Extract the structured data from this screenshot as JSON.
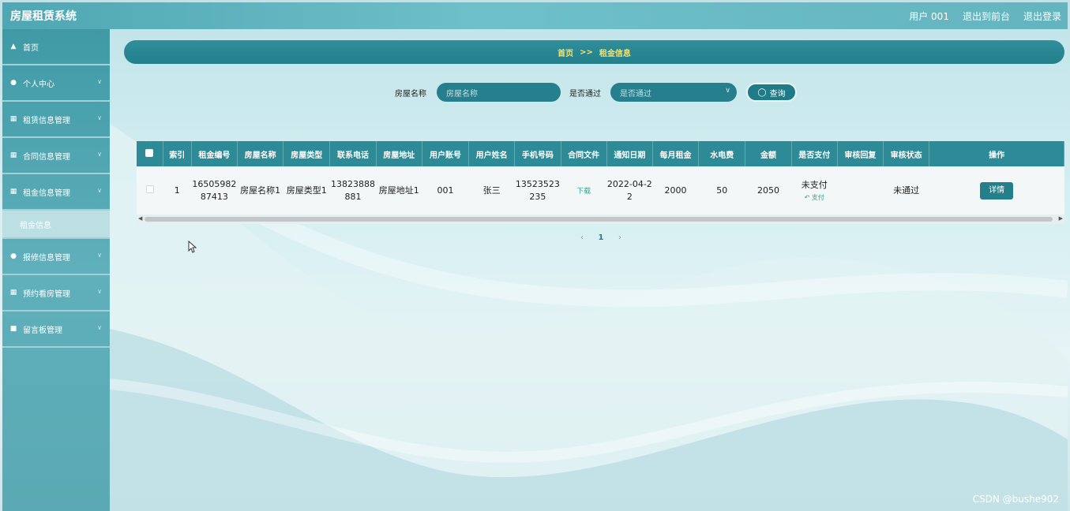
{
  "header": {
    "brand": "房屋租赁系统",
    "user": "用户 001",
    "back_to_front": "退出到前台",
    "logout": "退出登录"
  },
  "sidebar": {
    "items": [
      {
        "label": "首页",
        "icon": "home-icon",
        "has_chevron": false
      },
      {
        "label": "个人中心",
        "icon": "person-icon",
        "has_chevron": true
      },
      {
        "label": "租赁信息管理",
        "icon": "grid-icon",
        "has_chevron": true
      },
      {
        "label": "合同信息管理",
        "icon": "grid-icon",
        "has_chevron": true
      },
      {
        "label": "租金信息管理",
        "icon": "grid-icon",
        "has_chevron": true
      },
      {
        "label": "报修信息管理",
        "icon": "person-icon",
        "has_chevron": true
      },
      {
        "label": "预约看房管理",
        "icon": "grid-icon",
        "has_chevron": true
      },
      {
        "label": "留言板管理",
        "icon": "note-icon",
        "has_chevron": true
      }
    ],
    "submenu_active": "租金信息"
  },
  "breadcrumb": {
    "home": "首页",
    "separator": ">>",
    "current": "租金信息"
  },
  "search": {
    "house_name_label": "房屋名称",
    "house_name_placeholder": "房屋名称",
    "approved_label": "是否通过",
    "approved_placeholder": "是否通过",
    "query_button": "查询"
  },
  "table": {
    "columns": [
      "索引",
      "租金编号",
      "房屋名称",
      "房屋类型",
      "联系电话",
      "房屋地址",
      "用户账号",
      "用户姓名",
      "手机号码",
      "合同文件",
      "通知日期",
      "每月租金",
      "水电费",
      "金额",
      "是否支付",
      "审核回复",
      "审核状态",
      "操作"
    ],
    "rows": [
      {
        "index": "1",
        "rent_no": "1650598287413",
        "house_name": "房屋名称1",
        "house_type": "房屋类型1",
        "phone": "13823888881",
        "address": "房屋地址1",
        "account": "001",
        "user_name": "张三",
        "mobile": "13523523235",
        "contract": "下载",
        "notice_date": "2022-04-22",
        "monthly_rent": "2000",
        "utilities": "50",
        "amount": "2050",
        "paid": "未支付",
        "pay_link": "支付",
        "reply": "",
        "status": "未通过",
        "action": "详情"
      }
    ]
  },
  "pagination": {
    "current_page": "1",
    "prev": "‹",
    "next": "›"
  },
  "watermark": "CSDN @bushe902",
  "colors": {
    "accent": "#247f8b",
    "sidebar": "#4fa3ae",
    "link": "#2aa58f",
    "breadcrumb_text": "#ffe063"
  }
}
